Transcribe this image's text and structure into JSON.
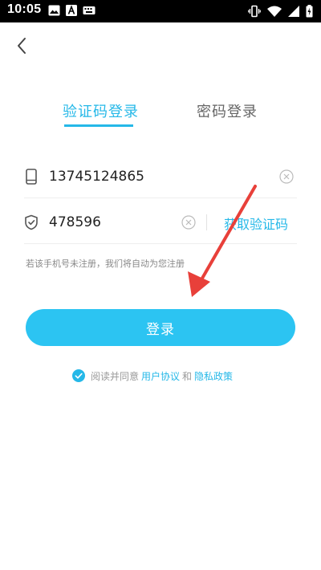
{
  "status_bar": {
    "time": "10:05",
    "left_icons": [
      "gallery-icon",
      "font-icon",
      "keyboard-icon"
    ],
    "right_icons": [
      "vibrate-icon",
      "wifi-icon",
      "signal-icon",
      "battery-charging-icon"
    ]
  },
  "header": {
    "back_icon": "chevron-left-icon"
  },
  "tabs": {
    "sms_login": "验证码登录",
    "password_login": "密码登录",
    "active": "sms_login"
  },
  "form": {
    "phone": {
      "value": "13745124865",
      "icon": "phone-icon"
    },
    "code": {
      "value": "478596",
      "icon": "shield-icon",
      "get_code_label": "获取验证码"
    },
    "hint": "若该手机号未注册，我们将自动为您注册"
  },
  "login_button": {
    "label": "登录"
  },
  "agreement": {
    "checked": true,
    "prefix": "阅读并同意",
    "user_agreement": "用户协议",
    "and": "和",
    "privacy_policy": "隐私政策"
  },
  "colors": {
    "accent": "#25b8e8",
    "button": "#2cc4f2",
    "annotation": "#e8403a"
  }
}
